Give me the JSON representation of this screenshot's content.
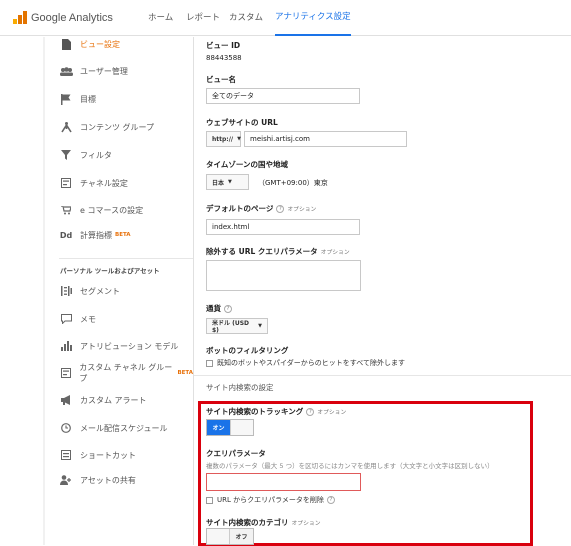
{
  "topbar": {
    "logo_text": "Google Analytics",
    "nav": [
      "ホーム",
      "レポート",
      "カスタム",
      "アナリティクス設定"
    ]
  },
  "sidebar": {
    "items": [
      {
        "label": "ビュー設定",
        "icon": "document-icon"
      },
      {
        "label": "ユーザー管理",
        "icon": "users-icon"
      },
      {
        "label": "目標",
        "icon": "flag-icon"
      },
      {
        "label": "コンテンツ グループ",
        "icon": "person-walking-icon"
      },
      {
        "label": "フィルタ",
        "icon": "filter-icon"
      },
      {
        "label": "チャネル設定",
        "icon": "channel-settings-icon"
      },
      {
        "label": "e コマースの設定",
        "icon": "cart-icon"
      },
      {
        "label": "計算指標",
        "icon": "dd-icon",
        "badge": "BETA"
      }
    ],
    "section_heading": "パーソナル ツールおよびアセット",
    "tools": [
      {
        "label": "セグメント",
        "icon": "segment-icon"
      },
      {
        "label": "メモ",
        "icon": "comment-icon"
      },
      {
        "label": "アトリビューション モデル",
        "icon": "bar-chart-icon"
      },
      {
        "label": "カスタム チャネル グループ",
        "icon": "custom-channel-icon",
        "badge": "BETA"
      },
      {
        "label": "カスタム アラート",
        "icon": "megaphone-icon"
      },
      {
        "label": "メール配信スケジュール",
        "icon": "clock-icon"
      },
      {
        "label": "ショートカット",
        "icon": "shortcut-icon"
      },
      {
        "label": "アセットの共有",
        "icon": "share-user-icon"
      }
    ]
  },
  "form": {
    "view_id_label": "ビュー ID",
    "view_id_value": "88443588",
    "view_name_label": "ビュー名",
    "view_name_value": "全てのデータ",
    "website_url_label": "ウェブサイトの URL",
    "protocol": "http://",
    "url_value": "meishi.artisj.com",
    "timezone_label": "タイムゾーンの国や地域",
    "country": "日本",
    "timezone_value": "（GMT+09:00）東京",
    "default_page_label": "デフォルトのページ",
    "option_text": "オプション",
    "default_page_value": "index.html",
    "exclude_params_label": "除外する URL クエリパラメータ",
    "currency_label": "通貨",
    "currency_value": "米ドル (USD $)",
    "bot_filter_label": "ボットのフィルタリング",
    "bot_filter_checkbox": "既知のボットやスパイダーからのヒットをすべて除外します",
    "site_search_section": "サイト内検索の設定",
    "tracking_label": "サイト内検索のトラッキング",
    "toggle_on": "オン",
    "query_param_label": "クエリパラメータ",
    "query_param_hint": "複数のパラメータ（最大 5 つ）を区切るにはカンマを使用します（大文字と小文字は区別しない）",
    "strip_query_checkbox": "URL からクエリパラメータを削除",
    "category_label": "サイト内検索のカテゴリ",
    "toggle_off": "オフ",
    "help_glyph": "?"
  },
  "colors": {
    "accent": "#1a73e8",
    "active_sidebar": "#e8710a",
    "highlight_border": "#d9000d"
  }
}
